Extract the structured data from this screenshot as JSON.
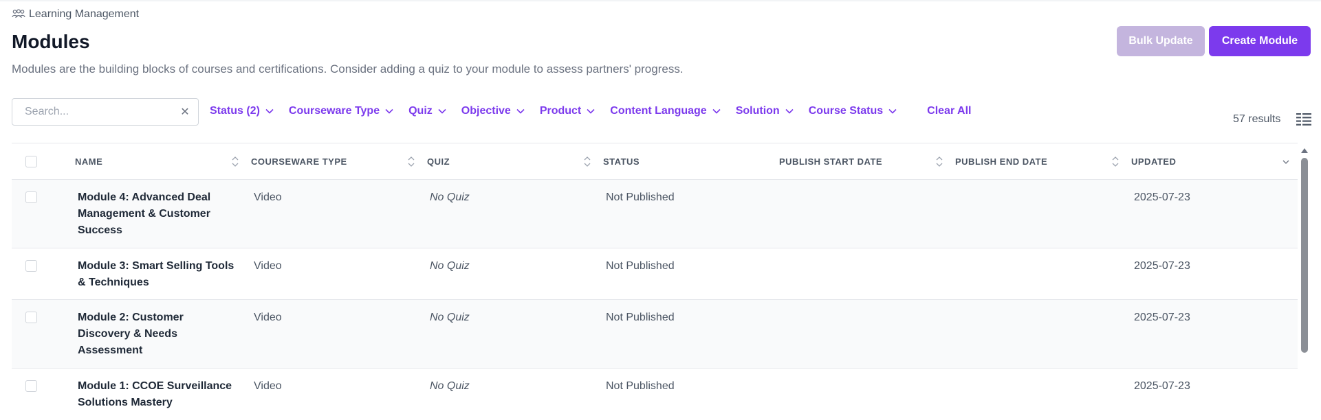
{
  "header": {
    "breadcrumb": "Learning Management",
    "title": "Modules",
    "description": "Modules are the building blocks of courses and certifications. Consider adding a quiz to your module to assess partners' progress.",
    "bulk_update_label": "Bulk Update",
    "create_module_label": "Create Module"
  },
  "toolbar": {
    "search_placeholder": "Search...",
    "filters": [
      "Status (2)",
      "Courseware Type",
      "Quiz",
      "Objective",
      "Product",
      "Content Language",
      "Solution",
      "Course Status"
    ],
    "clear_all_label": "Clear All",
    "results_text": "57 results"
  },
  "table": {
    "columns": [
      "NAME",
      "COURSEWARE TYPE",
      "QUIZ",
      "STATUS",
      "PUBLISH START DATE",
      "PUBLISH END DATE",
      "UPDATED"
    ],
    "rows": [
      {
        "name": "Module 4: Advanced Deal Management & Customer Success",
        "courseware_type": "Video",
        "quiz": "No Quiz",
        "status": "Not Published",
        "publish_start": "",
        "publish_end": "",
        "updated": "2025-07-23"
      },
      {
        "name": "Module 3: Smart Selling Tools & Techniques",
        "courseware_type": "Video",
        "quiz": "No Quiz",
        "status": "Not Published",
        "publish_start": "",
        "publish_end": "",
        "updated": "2025-07-23"
      },
      {
        "name": "Module 2: Customer Discovery & Needs Assessment",
        "courseware_type": "Video",
        "quiz": "No Quiz",
        "status": "Not Published",
        "publish_start": "",
        "publish_end": "",
        "updated": "2025-07-23"
      },
      {
        "name": "Module 1: CCOE Surveillance Solutions Mastery",
        "courseware_type": "Video",
        "quiz": "No Quiz",
        "status": "Not Published",
        "publish_start": "",
        "publish_end": "",
        "updated": "2025-07-23"
      }
    ]
  },
  "colors": {
    "accent": "#7c3aed",
    "accent_disabled": "#c4b5de"
  }
}
